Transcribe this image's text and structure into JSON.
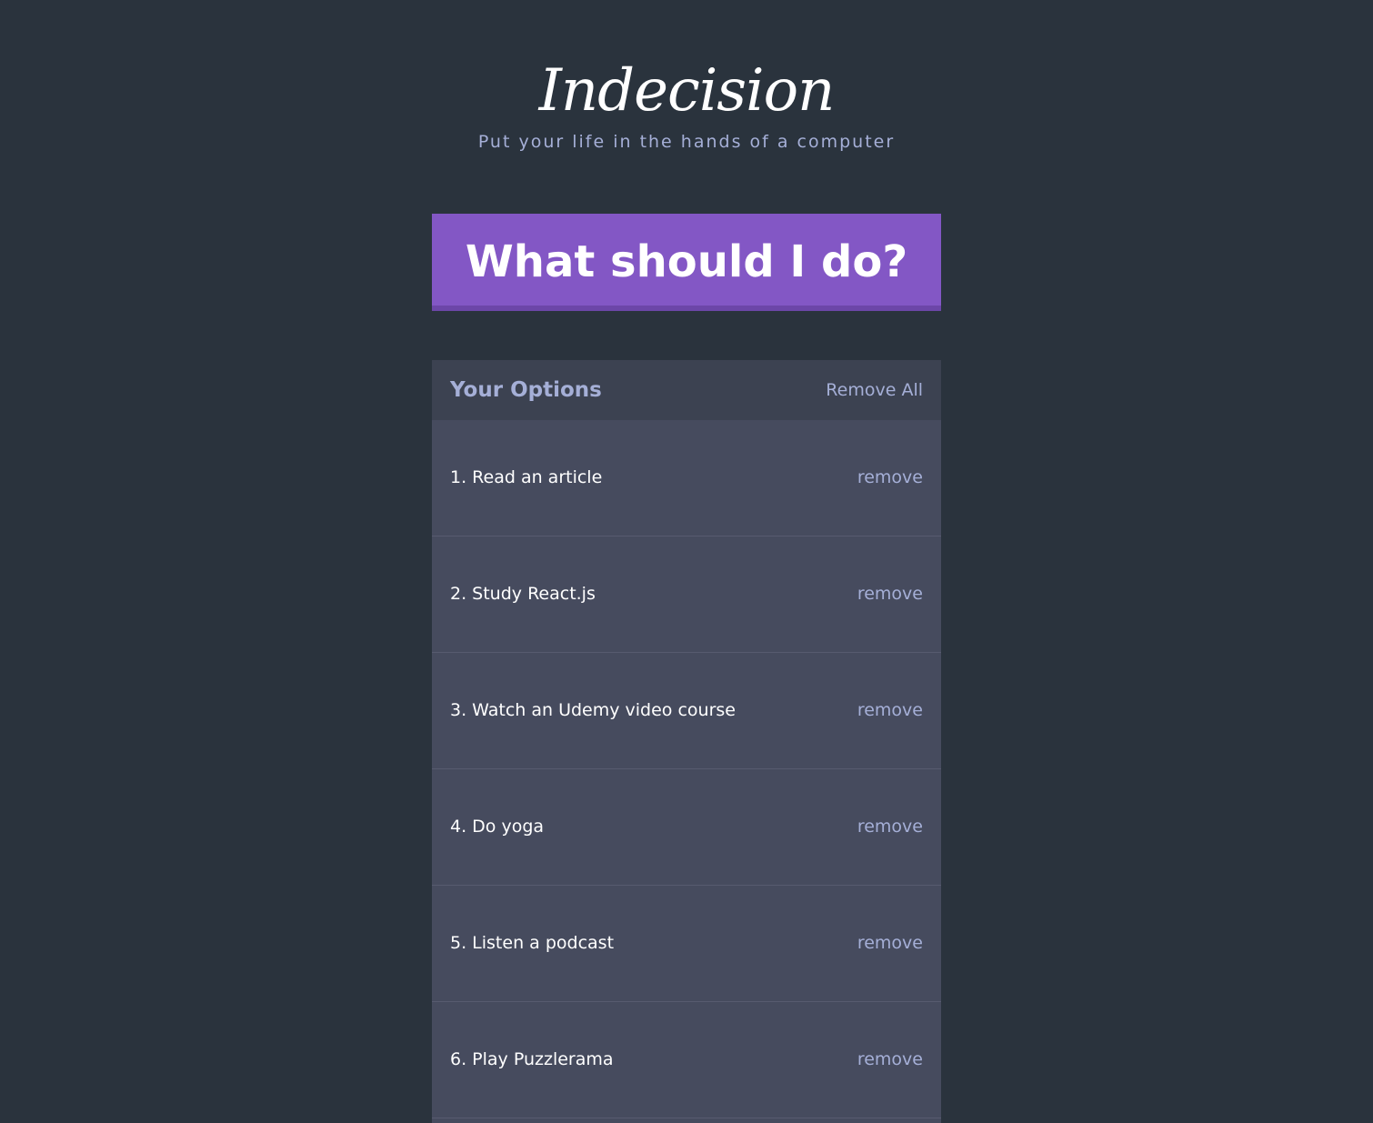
{
  "header": {
    "title": "Indecision",
    "subtitle": "Put your life in the hands of a computer"
  },
  "action": {
    "label": "What should I do?"
  },
  "options_widget": {
    "title": "Your Options",
    "remove_all_label": "Remove All",
    "remove_label": "remove",
    "items": [
      {
        "text": "1. Read an article"
      },
      {
        "text": "2. Study React.js"
      },
      {
        "text": "3. Watch an Udemy video course"
      },
      {
        "text": "4. Do yoga"
      },
      {
        "text": "5. Listen a podcast"
      },
      {
        "text": "6. Play Puzzlerama"
      }
    ]
  },
  "colors": {
    "background": "#2a333d",
    "accent": "#8357c5",
    "muted_text": "#a5afd7",
    "widget_bg": "#464b5e",
    "widget_header_bg": "#3c4251"
  }
}
